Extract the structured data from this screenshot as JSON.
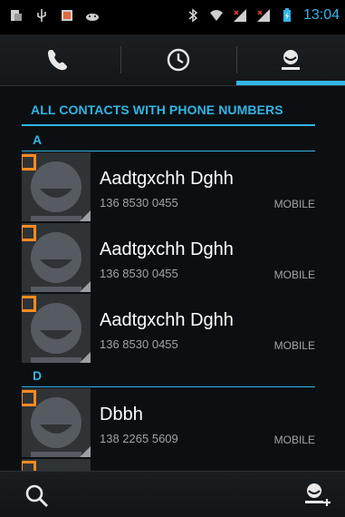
{
  "status_bar": {
    "time": "13:04",
    "left_icons": [
      "screenshot-icon",
      "usb-icon",
      "gallery-icon",
      "android-icon"
    ],
    "right_icons": [
      "bluetooth-icon",
      "wifi-icon",
      "signal-icon",
      "signal-icon",
      "battery-charging-icon"
    ]
  },
  "tabs": [
    {
      "name": "phone",
      "icon": "phone-icon",
      "selected": false
    },
    {
      "name": "recent",
      "icon": "clock-icon",
      "selected": false
    },
    {
      "name": "contacts",
      "icon": "person-icon",
      "selected": true
    }
  ],
  "list": {
    "header": "ALL CONTACTS WITH PHONE NUMBERS",
    "sections": [
      {
        "letter": "A",
        "contacts": [
          {
            "name": "Aadtgxchh Dghh",
            "phone": "136 8530 0455",
            "type": "MOBILE"
          },
          {
            "name": "Aadtgxchh Dghh",
            "phone": "136 8530 0455",
            "type": "MOBILE"
          },
          {
            "name": "Aadtgxchh Dghh",
            "phone": "136 8530 0455",
            "type": "MOBILE"
          }
        ]
      },
      {
        "letter": "D",
        "contacts": [
          {
            "name": "Dbbh",
            "phone": "138 2265 5609",
            "type": "MOBILE"
          }
        ]
      }
    ]
  },
  "bottom_bar": {
    "left_icon": "search-icon",
    "right_icon": "add-contact-icon"
  },
  "colors": {
    "accent": "#33b5e5",
    "badge": "#ff8a1f",
    "background": "#0b0f12"
  }
}
